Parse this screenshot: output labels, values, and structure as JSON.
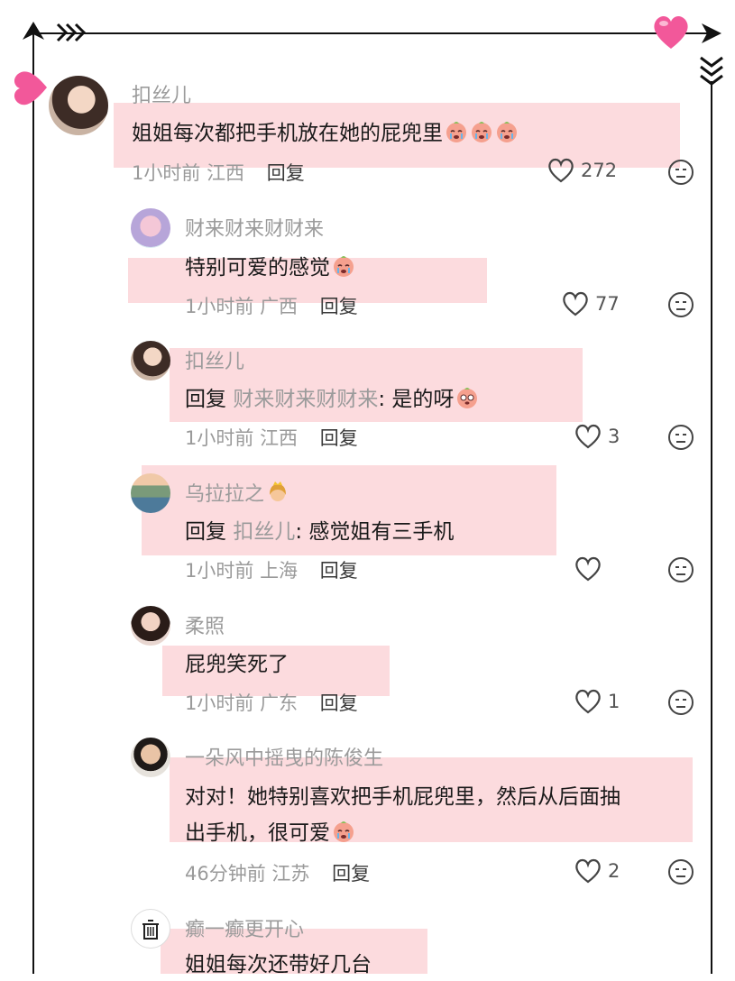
{
  "comments": [
    {
      "name": "扣丝儿",
      "text": "姐姐每次都把手机放在她的屁兜里",
      "emoji_count": 3,
      "time": "1小时前",
      "location": "江西",
      "reply": "回复",
      "likes": "272"
    },
    {
      "name": "财来财来财财来",
      "text": "特别可爱的感觉",
      "time": "1小时前",
      "location": "广西",
      "reply": "回复",
      "likes": "77"
    },
    {
      "name": "扣丝儿",
      "reply_prefix": "回复",
      "reply_to": "财来财来财财来",
      "text": ": 是的呀",
      "time": "1小时前",
      "location": "江西",
      "reply": "回复",
      "likes": "3"
    },
    {
      "name": "乌拉拉之",
      "reply_prefix": "回复",
      "reply_to": "扣丝儿",
      "text": ": 感觉姐有三手机",
      "time": "1小时前",
      "location": "上海",
      "reply": "回复",
      "likes": ""
    },
    {
      "name": "柔照",
      "text": "屁兜笑死了",
      "time": "1小时前",
      "location": "广东",
      "reply": "回复",
      "likes": "1"
    },
    {
      "name": "一朵风中摇曳的陈俊生",
      "text_line1": "对对！她特别喜欢把手机屁兜里，然后从后面抽",
      "text_line2": "出手机，很可爱",
      "time": "46分钟前",
      "location": "江苏",
      "reply": "回复",
      "likes": "2"
    },
    {
      "name": "癫一癫更开心",
      "text": "姐姐每次还带好几台"
    }
  ],
  "icons": {
    "like": "heart-outline-icon",
    "dislike": "meh-face-icon",
    "emoji": "crying-peach-emoji",
    "crown": "princess-emoji"
  },
  "colors": {
    "highlight": "#f9c8cd",
    "heart_accent": "#f0508e",
    "frame": "#111111"
  }
}
